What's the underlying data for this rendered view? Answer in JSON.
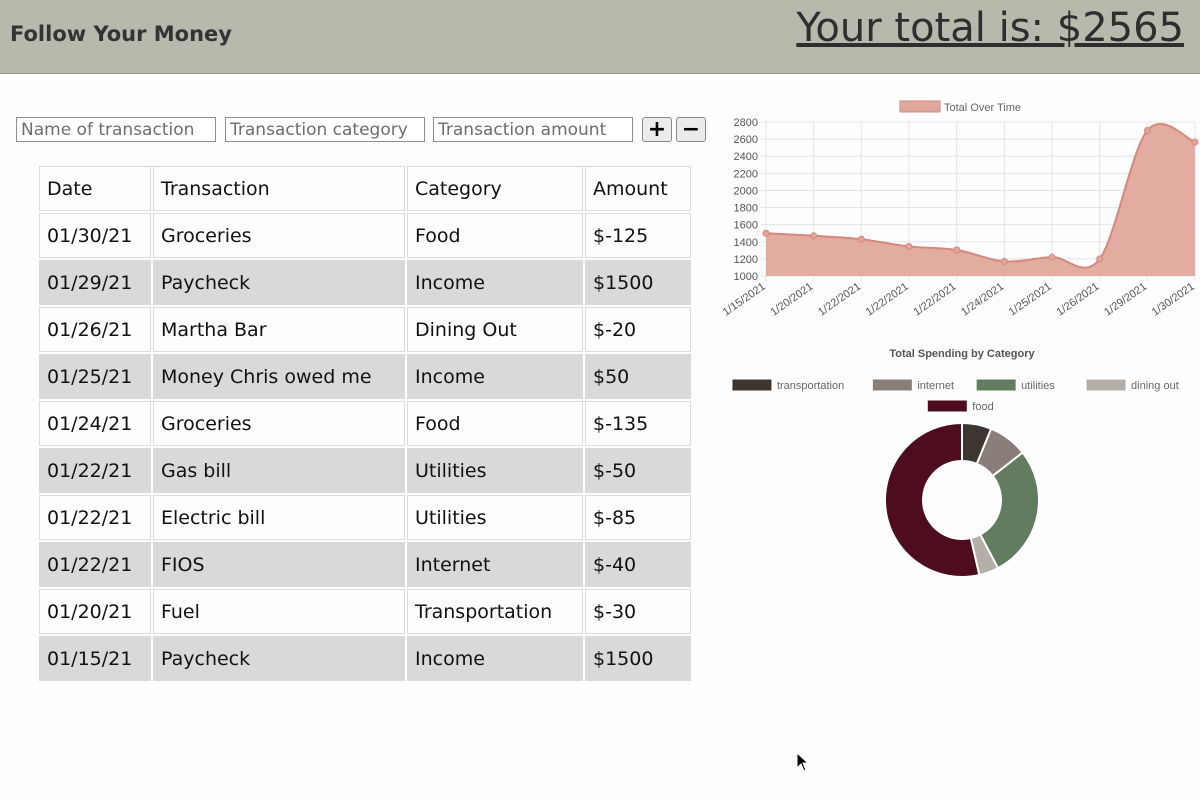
{
  "header": {
    "title": "Follow Your Money",
    "total_label": "Your total is: $2565"
  },
  "form": {
    "name_placeholder": "Name of transaction",
    "category_placeholder": "Transaction category",
    "amount_placeholder": "Transaction amount",
    "add_label": "+",
    "subtract_label": "−"
  },
  "table": {
    "headers": [
      "Date",
      "Transaction",
      "Category",
      "Amount"
    ],
    "rows": [
      [
        "01/30/21",
        "Groceries",
        "Food",
        "$-125"
      ],
      [
        "01/29/21",
        "Paycheck",
        "Income",
        "$1500"
      ],
      [
        "01/26/21",
        "Martha Bar",
        "Dining Out",
        "$-20"
      ],
      [
        "01/25/21",
        "Money Chris owed me",
        "Income",
        "$50"
      ],
      [
        "01/24/21",
        "Groceries",
        "Food",
        "$-135"
      ],
      [
        "01/22/21",
        "Gas bill",
        "Utilities",
        "$-50"
      ],
      [
        "01/22/21",
        "Electric bill",
        "Utilities",
        "$-85"
      ],
      [
        "01/22/21",
        "FIOS",
        "Internet",
        "$-40"
      ],
      [
        "01/20/21",
        "Fuel",
        "Transportation",
        "$-30"
      ],
      [
        "01/15/21",
        "Paycheck",
        "Income",
        "$1500"
      ]
    ]
  },
  "colors": {
    "line_fill": "#e0a89c",
    "line_stroke": "#d4897c",
    "header_bg": "#b9b8ad"
  },
  "chart_data": [
    {
      "type": "area",
      "title": "",
      "legend": [
        "Total Over Time"
      ],
      "legend_position": "top",
      "categories": [
        "1/15/2021",
        "1/20/2021",
        "1/22/2021",
        "1/22/2021",
        "1/22/2021",
        "1/24/2021",
        "1/25/2021",
        "1/26/2021",
        "1/29/2021",
        "1/30/2021"
      ],
      "series": [
        {
          "name": "Total Over Time",
          "values": [
            1500,
            1470,
            1430,
            1345,
            1305,
            1170,
            1220,
            1200,
            2700,
            2565
          ]
        }
      ],
      "ylim": [
        1000,
        2800
      ],
      "yticks": [
        1000,
        1200,
        1400,
        1600,
        1800,
        2000,
        2200,
        2400,
        2600,
        2800
      ],
      "grid": true
    },
    {
      "type": "pie",
      "title": "Total Spending by Category",
      "legend_position": "top",
      "labels": [
        "transportation",
        "internet",
        "utilities",
        "dining out",
        "food"
      ],
      "values": [
        30,
        40,
        135,
        20,
        260
      ],
      "colors": [
        "#3d3530",
        "#8a7f78",
        "#617c5f",
        "#b3afa8",
        "#4e0d1f"
      ]
    }
  ]
}
